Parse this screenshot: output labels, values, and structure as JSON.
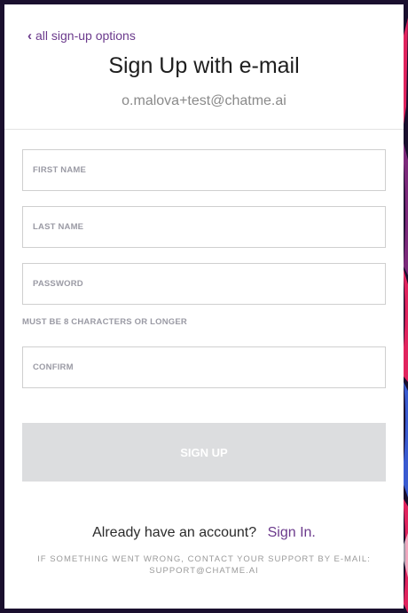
{
  "header": {
    "back_link": "all sign-up options",
    "title": "Sign Up with e-mail",
    "email": "o.malova+test@chatme.ai"
  },
  "form": {
    "first_name_placeholder": "FIRST NAME",
    "last_name_placeholder": "LAST NAME",
    "password_placeholder": "PASSWORD",
    "password_hint": "MUST BE 8 CHARACTERS OR LONGER",
    "confirm_placeholder": "CONFIRM",
    "submit_label": "SIGN UP"
  },
  "footer": {
    "have_account_text": "Already have an account?",
    "signin_label": "Sign In.",
    "support_text": "IF SOMETHING WENT WRONG, CONTACT YOUR SUPPORT BY E-MAIL: SUPPORT@CHATME.AI"
  },
  "colors": {
    "accent": "#6b3a8c",
    "disabled_button": "#dcdddf",
    "background": "#1a0f2e"
  },
  "icons": {
    "back": "chevron-left-icon"
  }
}
